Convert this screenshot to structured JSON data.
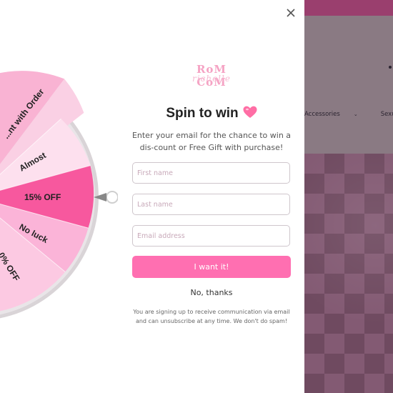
{
  "background_store": {
    "nav_items": [
      "Accessories",
      "Sexual Heal"
    ]
  },
  "popup": {
    "close_icon": "close-icon",
    "logo": {
      "main": "RoM CoM",
      "sub": "richelle"
    },
    "title": "Spin to win",
    "title_icon": "heart-icon",
    "subtitle": "Enter your email for the chance to win a dis-count or Free Gift with purchase!",
    "fields": {
      "first_name": {
        "placeholder": "First name",
        "value": ""
      },
      "last_name": {
        "placeholder": "Last name",
        "value": ""
      },
      "email": {
        "placeholder": "Email address",
        "value": ""
      }
    },
    "cta_label": "I want it!",
    "decline_label": "No, thanks",
    "disclaimer": "You are signing up to receive communication via email and can unsubscribe at any time. We don't do spam!"
  },
  "wheel": {
    "segments": [
      {
        "label": "...nt with Order",
        "color": "#f9b3d3"
      },
      {
        "label": "Almost",
        "color": "#fde0ee"
      },
      {
        "label": "15% OFF",
        "color": "#f7589e"
      },
      {
        "label": "No luck",
        "color": "#fbb4d8"
      },
      {
        "label": "...0% OFF",
        "color": "#fcc9e2"
      }
    ],
    "pointer_icon": "wheel-pointer-icon"
  },
  "colors": {
    "accent": "#ff6fb1",
    "wheel_highlight": "#f7589e",
    "overlay": "#6e4b5e"
  }
}
